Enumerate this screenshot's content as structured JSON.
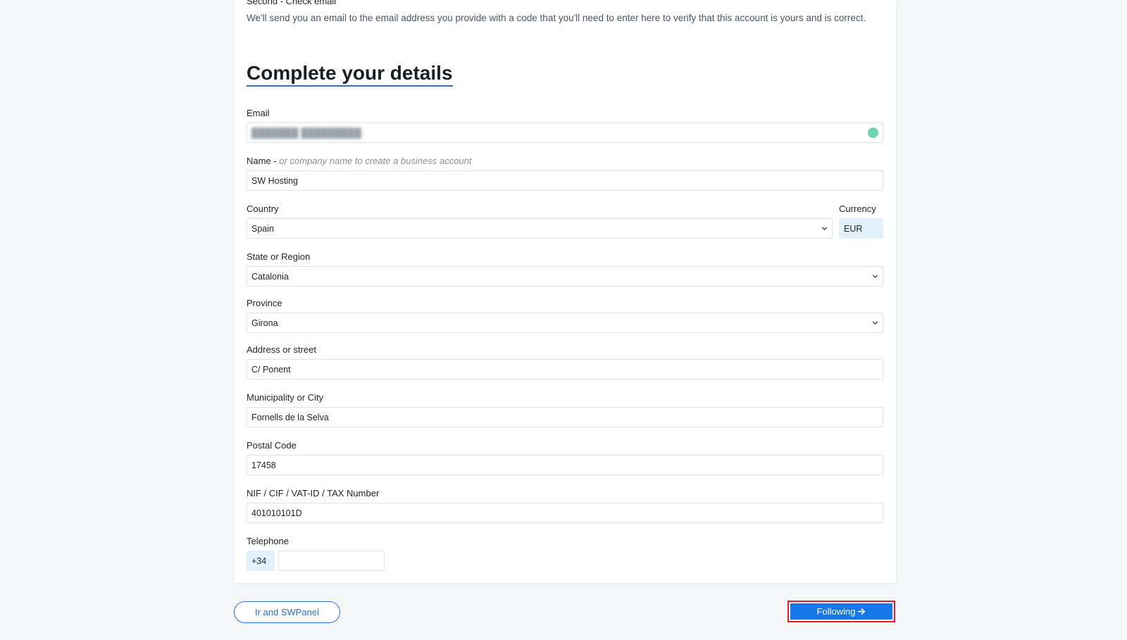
{
  "verify": {
    "title": "Second - Check email",
    "description": "We'll send you an email to the email address you provide with a code that you'll need to enter here to verify that this account is yours and is correct."
  },
  "form": {
    "title": "Complete your details",
    "email": {
      "label": "Email",
      "value": "███████ █████████"
    },
    "name": {
      "label": "Name - ",
      "hint": "or company name to create a business account",
      "value": "SW Hosting"
    },
    "country": {
      "label": "Country",
      "value": "Spain"
    },
    "currency": {
      "label": "Currency",
      "value": "EUR"
    },
    "state": {
      "label": "State or Region",
      "value": "Catalonia"
    },
    "province": {
      "label": "Province",
      "value": "Girona"
    },
    "address": {
      "label": "Address or street",
      "value": "C/ Ponent"
    },
    "city": {
      "label": "Municipality or City",
      "value": "Fornells de la Selva"
    },
    "postal": {
      "label": "Postal Code",
      "value": "17458"
    },
    "tax": {
      "label": "NIF / CIF / VAT-ID / TAX Number",
      "value": "401010101D"
    },
    "phone": {
      "label": "Telephone",
      "prefix": "+34",
      "value": ""
    }
  },
  "actions": {
    "back_label": "Ir and SWPanel",
    "next_label": "Following"
  },
  "colors": {
    "accent": "#1677e8",
    "highlight_border": "#e11d2a",
    "valid_dot": "#6fd3b4",
    "tinted_field": "#e3f1fd"
  },
  "icons": {
    "select": "chevron-down-icon",
    "next": "arrow-right-icon",
    "email_status": "check-status-icon"
  }
}
